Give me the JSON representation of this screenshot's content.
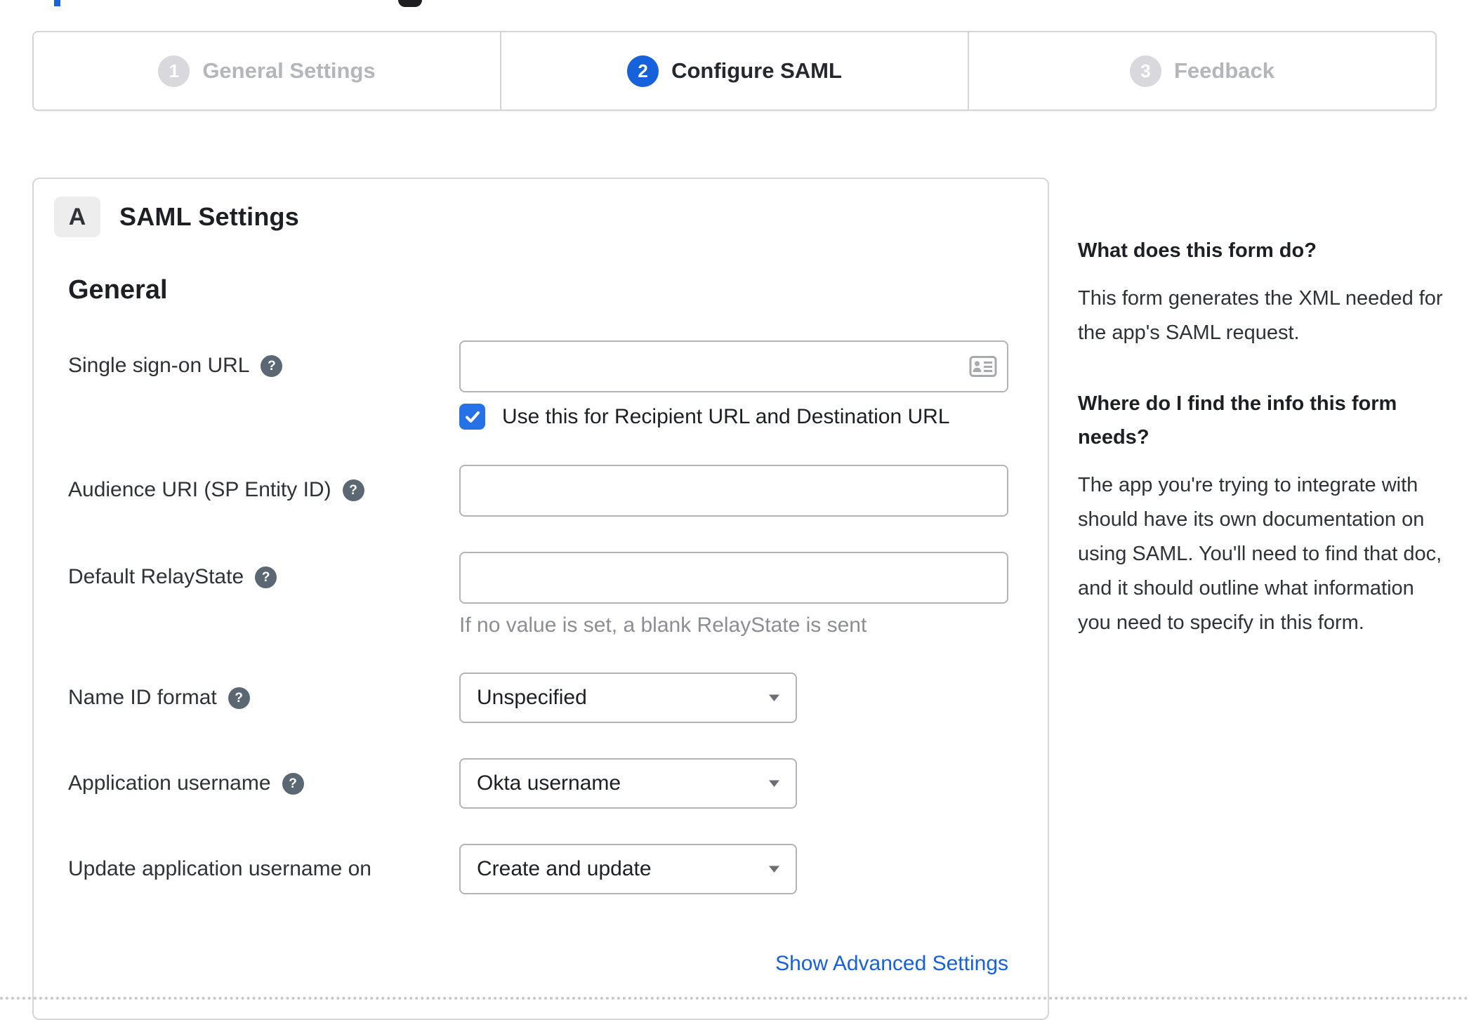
{
  "stepper": {
    "steps": [
      {
        "number": "1",
        "label": "General Settings",
        "state": "inactive"
      },
      {
        "number": "2",
        "label": "Configure SAML",
        "state": "active"
      },
      {
        "number": "3",
        "label": "Feedback",
        "state": "inactive"
      }
    ]
  },
  "panel": {
    "badge": "A",
    "title": "SAML Settings",
    "section_heading": "General",
    "fields": [
      {
        "label": "Single sign-on URL",
        "has_help": true,
        "type": "text",
        "value": "",
        "checkbox_label": "Use this for Recipient URL and Destination URL",
        "checkbox_checked": true
      },
      {
        "label": "Audience URI (SP Entity ID)",
        "has_help": true,
        "type": "text",
        "value": ""
      },
      {
        "label": "Default RelayState",
        "has_help": true,
        "type": "text",
        "value": "",
        "hint": "If no value is set, a blank RelayState is sent"
      },
      {
        "label": "Name ID format",
        "has_help": true,
        "type": "select",
        "value": "Unspecified"
      },
      {
        "label": "Application username",
        "has_help": true,
        "type": "select",
        "value": "Okta username"
      },
      {
        "label": "Update application username on",
        "has_help": false,
        "type": "select",
        "value": "Create and update"
      }
    ],
    "advanced_link": "Show Advanced Settings"
  },
  "sidebar": {
    "sections": [
      {
        "heading": "What does this form do?",
        "body": "This form generates the XML needed for the app's SAML request."
      },
      {
        "heading": "Where do I find the info this form needs?",
        "body": "The app you're trying to integrate with should have its own documentation on using SAML. You'll need to find that doc, and it should outline what information you need to specify in this form."
      }
    ]
  },
  "icons": {
    "help_glyph": "?"
  },
  "colors": {
    "accent_blue": "#1662dd",
    "checkbox_blue": "#2571e8",
    "step_inactive_gray": "#d9d9dd",
    "link_blue": "#1662dd"
  }
}
